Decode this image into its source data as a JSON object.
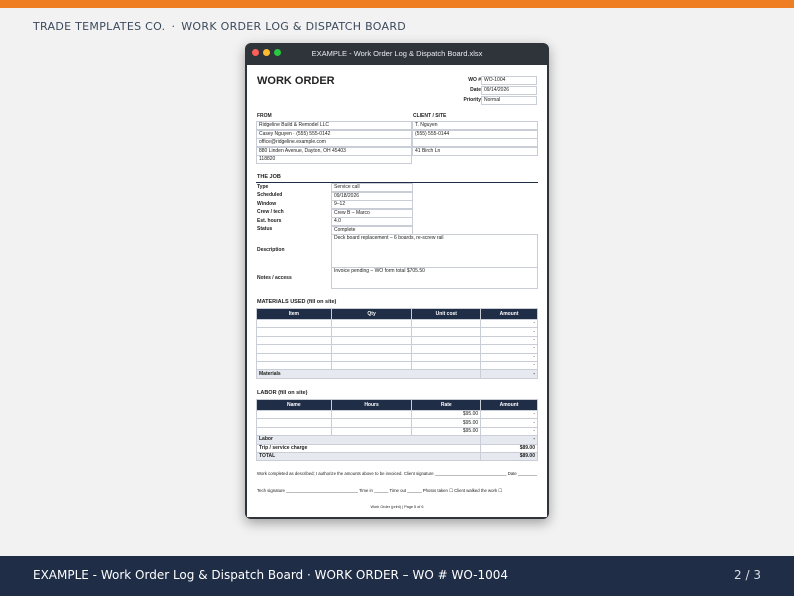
{
  "header": {
    "brand": "TRADE TEMPLATES CO.",
    "separator": "·",
    "subtitle": "WORK ORDER LOG & DISPATCH BOARD"
  },
  "window": {
    "title": "EXAMPLE - Work Order Log & Dispatch Board.xlsx"
  },
  "doc": {
    "title": "WORK ORDER",
    "meta": {
      "wo_label": "WO #",
      "wo_value": "WO-1004",
      "date_label": "Date",
      "date_value": "09/14/2026",
      "priority_label": "Priority",
      "priority_value": "Normal"
    },
    "from": {
      "heading": "FROM",
      "lines": [
        "Ridgeline Build & Remodel LLC",
        "Casey Nguyen · (555) 555-0142",
        "office@ridgeline.example.com",
        "880 Linden Avenue, Dayton, OH 45403",
        "118820"
      ]
    },
    "client": {
      "heading": "CLIENT / SITE",
      "lines": [
        "T. Nguyen",
        "(555) 555-0144",
        "",
        "41 Birch Ln"
      ]
    },
    "job": {
      "heading": "THE JOB",
      "type_label": "Type",
      "type_value": "Service call",
      "scheduled_label": "Scheduled",
      "scheduled_value": "09/18/2026",
      "window_label": "Window",
      "window_value": "9–12",
      "crew_label": "Crew / tech",
      "crew_value": "Crew B – Marco",
      "hours_label": "Est. hours",
      "hours_value": "4.0",
      "status_label": "Status",
      "status_value": "Complete",
      "description_label": "Description",
      "description_value": "Deck board replacement – 6 boards, re-screw rail",
      "notes_label": "Notes / access",
      "notes_value": "Invoice pending – WO form total $705.50"
    },
    "materials": {
      "heading": "MATERIALS USED (fill on site)",
      "columns": [
        "Item",
        "Qty",
        "Unit cost",
        "Amount"
      ],
      "blank_amount": "-",
      "total_label": "Materials",
      "total_value": "-"
    },
    "labor": {
      "heading": "LABOR (fill on site)",
      "columns": [
        "Name",
        "Hours",
        "Rate",
        "Amount"
      ],
      "rates": [
        "$95.00",
        "$95.00",
        "$95.00"
      ],
      "blank_amount": "-",
      "total_label": "Labor",
      "total_value": "-",
      "trip_label": "Trip / service charge",
      "trip_value": "$89.00",
      "grand_label": "TOTAL",
      "grand_value": "$89.00"
    },
    "signoff": {
      "line1": "Work completed as described; I authorize the amounts above to be invoiced.   Client signature ______________________________   Date ________",
      "line2": "Tech signature ______________________________   Time in ______   Time out ______   Photos taken ☐   Client walked the work ☐"
    },
    "page_footer": "Work Order (print)  |  Page 5 of 6"
  },
  "footer": {
    "title": "EXAMPLE - Work Order Log & Dispatch Board · WORK ORDER – WO # WO-1004",
    "page": "2 / 3"
  }
}
